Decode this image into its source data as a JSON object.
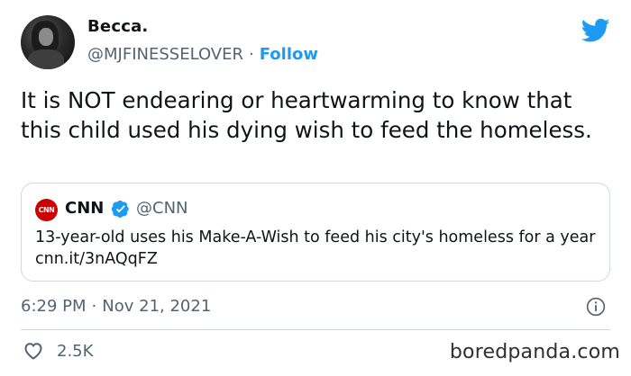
{
  "author": {
    "name": "Becca.",
    "handle": "@MJFINESSELOVER",
    "separator": "·",
    "follow_label": "Follow"
  },
  "tweet": {
    "text": "It is NOT endearing or heartwarming to know that this child used his dying wish to feed the homeless."
  },
  "quoted_tweet": {
    "logo_text": "CNN",
    "name": "CNN",
    "handle": "@CNN",
    "text": "13-year-old uses his Make-A-Wish to feed his city's homeless for a year cnn.it/3nAQqFZ"
  },
  "meta": {
    "time": "6:29 PM",
    "separator": "·",
    "date": "Nov 21, 2021"
  },
  "engagement": {
    "likes": "2.5K"
  },
  "watermark": "boredpanda.com",
  "colors": {
    "brand_blue": "#1d9bf0",
    "cnn_red": "#cc0000",
    "secondary_text": "#536471"
  },
  "icons": [
    "twitter-bird-icon",
    "verified-badge-icon",
    "info-icon",
    "heart-icon"
  ]
}
